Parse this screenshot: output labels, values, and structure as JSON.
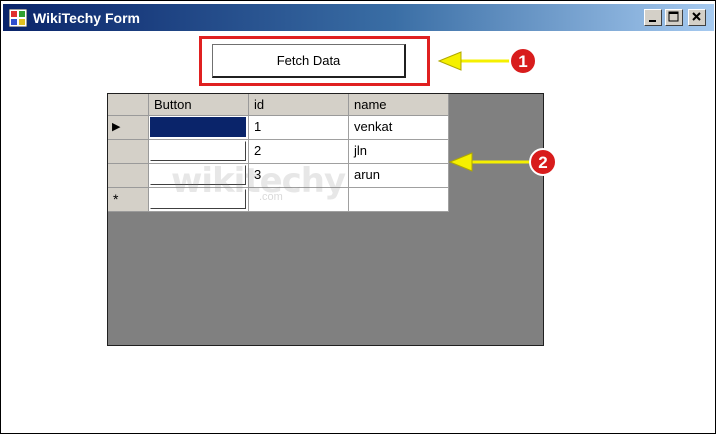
{
  "window": {
    "title": "WikiTechy Form"
  },
  "toolbar": {
    "fetch_label": "Fetch Data"
  },
  "grid": {
    "columns": [
      "Button",
      "id",
      "name"
    ],
    "rows": [
      {
        "id": "1",
        "name": "venkat",
        "current": true
      },
      {
        "id": "2",
        "name": "jln"
      },
      {
        "id": "3",
        "name": "arun"
      }
    ],
    "new_row_marker": "*",
    "current_marker": "▶"
  },
  "annotations": {
    "badge1": "1",
    "badge2": "2"
  },
  "watermark": {
    "text": "wikitechy",
    "sub": ".com"
  },
  "colors": {
    "highlight": "#e02020",
    "arrow": "#f5f000",
    "badge": "#d81c1c",
    "selection": "#0a246a",
    "grid_bg": "#808080"
  }
}
